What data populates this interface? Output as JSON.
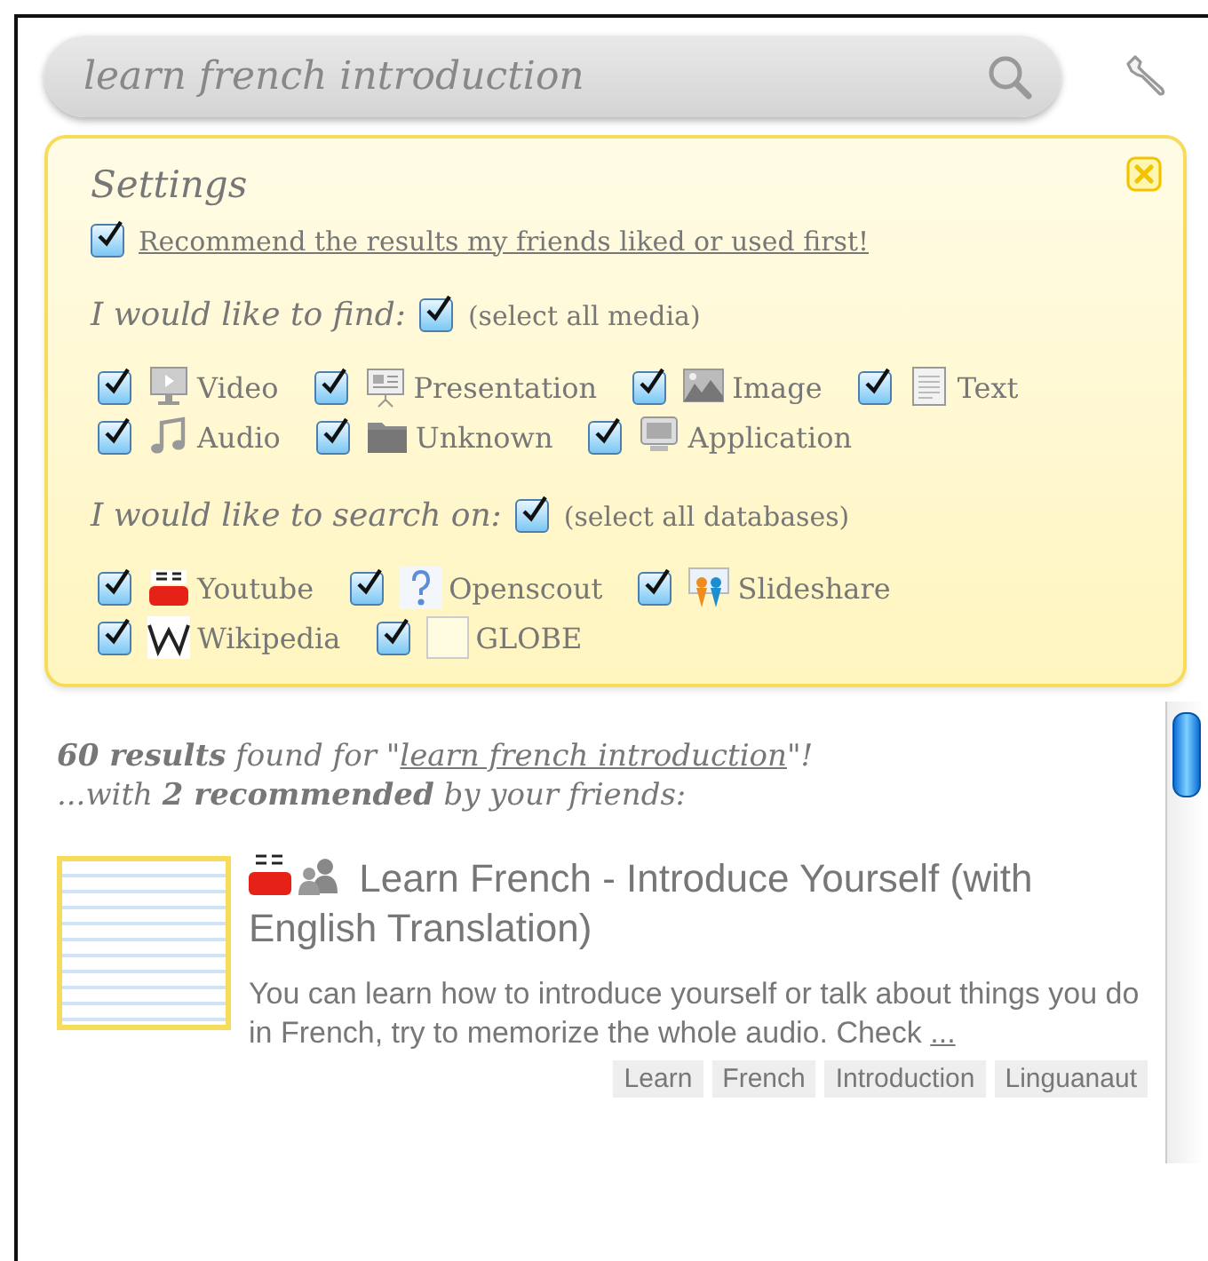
{
  "search": {
    "value": "learn french introduction"
  },
  "settings": {
    "title": "Settings",
    "recommend": {
      "label": "Recommend the results my friends liked or used first!",
      "checked": true
    },
    "media": {
      "heading": "I would like to find:",
      "select_all": {
        "label": "(select all media)",
        "checked": true
      },
      "rows": [
        [
          {
            "kind": "video",
            "label": "Video",
            "checked": true
          },
          {
            "kind": "presentation",
            "label": "Presentation",
            "checked": true
          },
          {
            "kind": "image",
            "label": "Image",
            "checked": true
          },
          {
            "kind": "text",
            "label": "Text",
            "checked": true
          }
        ],
        [
          {
            "kind": "audio",
            "label": "Audio",
            "checked": true
          },
          {
            "kind": "folder",
            "label": "Unknown",
            "checked": true
          },
          {
            "kind": "application",
            "label": "Application",
            "checked": true
          }
        ]
      ]
    },
    "databases": {
      "heading": "I would like to search on:",
      "select_all": {
        "label": "(select all databases)",
        "checked": true
      },
      "rows": [
        [
          {
            "kind": "youtube",
            "label": "Youtube",
            "checked": true
          },
          {
            "kind": "openscout",
            "label": "Openscout",
            "checked": true
          },
          {
            "kind": "slideshare",
            "label": "Slideshare",
            "checked": true
          }
        ],
        [
          {
            "kind": "wikipedia",
            "label": "Wikipedia",
            "checked": true
          },
          {
            "kind": "blank",
            "label": "GLOBE",
            "checked": true
          }
        ]
      ]
    }
  },
  "results": {
    "summary_prefix": "**60 results** found for \"",
    "summary_query": "learn french introduction",
    "summary_suffix": "\"!",
    "recommended": "...with **2 recommended** by your friends:",
    "items": [
      {
        "kind": "youtube",
        "title": "Learn French - Introduce Yourself (with English Translation)",
        "description": "You can learn how to introduce yourself or talk about things you do in French, try to memorize the whole audio. Check",
        "more": "...",
        "tags": [
          "Learn",
          "French",
          "Introduction",
          "Linguanaut"
        ]
      }
    ]
  }
}
